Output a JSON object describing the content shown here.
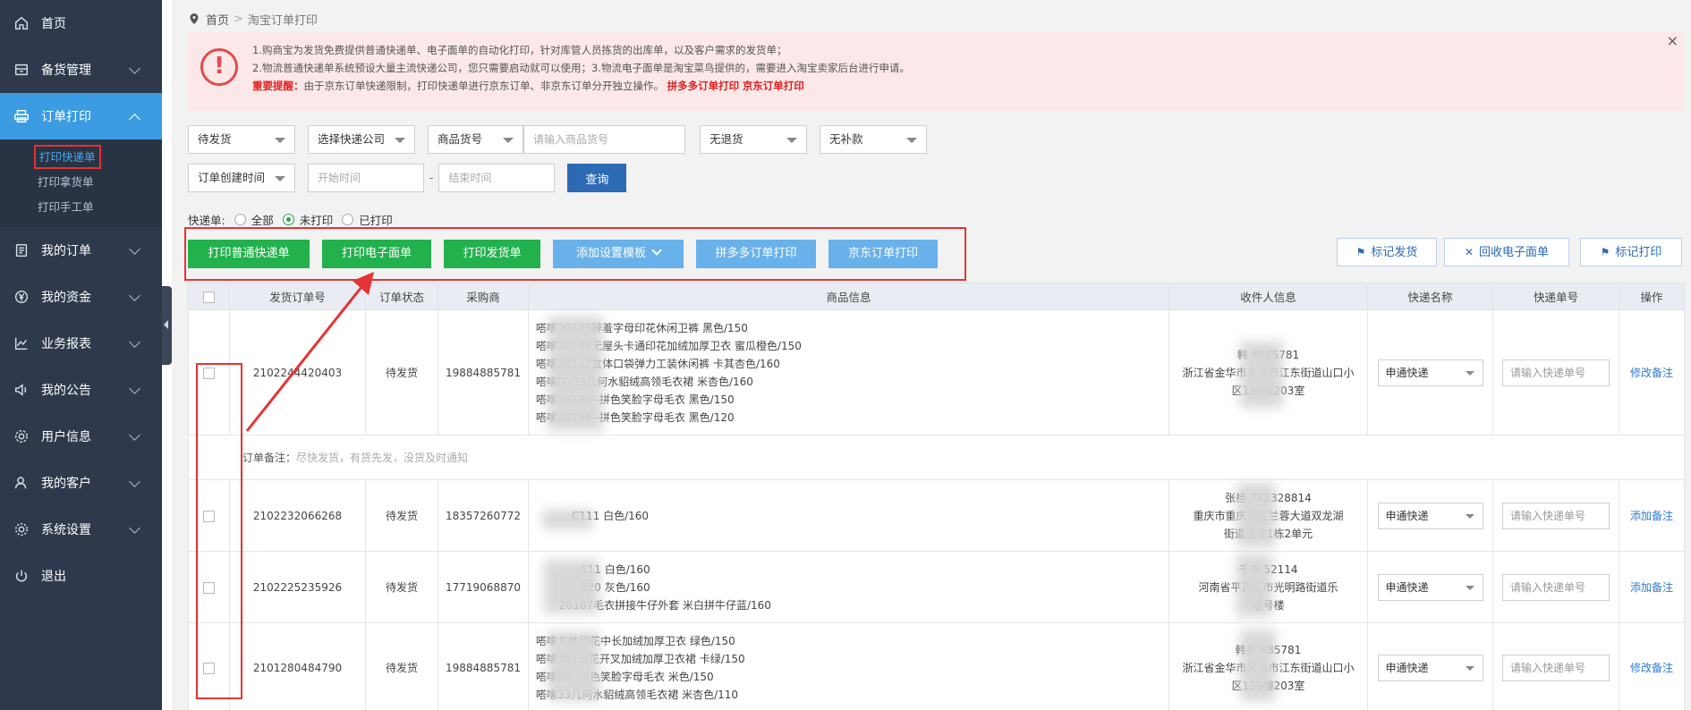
{
  "sidebar": {
    "items": [
      {
        "label": "首页",
        "icon": "home-icon"
      },
      {
        "label": "备货管理",
        "icon": "inventory-icon"
      },
      {
        "label": "订单打印",
        "icon": "printer-icon"
      },
      {
        "label": "我的订单",
        "icon": "order-icon"
      },
      {
        "label": "我的资金",
        "icon": "yen-icon"
      },
      {
        "label": "业务报表",
        "icon": "chart-icon"
      },
      {
        "label": "我的公告",
        "icon": "speaker-icon"
      },
      {
        "label": "用户信息",
        "icon": "user-gear-icon"
      },
      {
        "label": "我的客户",
        "icon": "customer-icon"
      },
      {
        "label": "系统设置",
        "icon": "settings-icon"
      },
      {
        "label": "退出",
        "icon": "power-icon"
      }
    ],
    "sub_items": [
      "打印快递单",
      "打印拿货单",
      "打印手工单"
    ]
  },
  "breadcrumb": {
    "home": "首页",
    "current": "淘宝订单打印"
  },
  "notice": {
    "line1": "1.购商宝为发货免费提供普通快递单、电子面单的自动化打印，针对库管人员拣货的出库单，以及客户需求的发货单；",
    "line2": "2.物流普通快递单系统预设大量主流快递公司，您只需要启动就可以使用；3.物流电子面单是淘宝菜鸟提供的，需要进入淘宝卖家后台进行申请。",
    "warn_label": "重要提醒：",
    "warn_text": "由于京东订单快递限制，打印快递单进行京东订单、非京东订单分开独立操作。",
    "link1": "拼多多订单打印",
    "link2": "京东订单打印",
    "close": "×"
  },
  "filters": {
    "status": "待发货",
    "express_company": "选择快递公司",
    "goods_field": "商品货号",
    "goods_placeholder": "请输入商品货号",
    "return": "无退货",
    "supplement": "无补款",
    "time_type": "订单创建时间",
    "start_placeholder": "开始时间",
    "end_placeholder": "结束时间",
    "dash": "-",
    "query": "查询"
  },
  "express_filter": {
    "label": "快递单:",
    "options": [
      "全部",
      "未打印",
      "已打印"
    ],
    "selected": "未打印"
  },
  "actions": {
    "print_normal": "打印普通快递单",
    "print_electronic": "打印电子面单",
    "print_delivery": "打印发货单",
    "add_template": "添加设置模板",
    "pdd_print": "拼多多订单打印",
    "jd_print": "京东订单打印",
    "mark_ship": "标记发货",
    "recycle": "回收电子面单",
    "mark_print": "标记打印"
  },
  "table": {
    "headers": [
      "发货订单号",
      "订单状态",
      "采购商",
      "商品信息",
      "收件人信息",
      "快递名称",
      "快递单号",
      "操作"
    ],
    "express_default": "申通快递",
    "tracking_placeholder": "请输入快递单号",
    "remark_label": "订单备注：",
    "remark_text": "尽快发货，有货先发，没货及时通知",
    "rows": [
      {
        "order_no": "2102244420403",
        "status": "待发货",
        "buyer": "19884885781",
        "goods": [
          "嗒嗦20123醉羞字母印花休闲卫裤  黑色/150",
          "嗒嗦20248无屋头卡通印花加绒加厚卫衣  蜜瓜橙色/150",
          "嗒嗦20122立体口袋弹力工装休闲裤  卡其杏色/160",
          "嗒嗦D733几何水貂绒高领毛衣裙  米杏色/160",
          "嗒嗦20199--拼色笑脸字母毛衣  黑色/150",
          "嗒嗦20199--拼色笑脸字母毛衣  黑色/120"
        ],
        "receiver": [
          "韩",
          "4885781",
          "浙江省金华市义乌市江东街道山口小",
          "区139幢203室"
        ],
        "op": "修改备注"
      },
      {
        "order_no": "2102232066268",
        "status": "待发货",
        "buyer": "18357260772",
        "goods": [
          "C111  白色/160"
        ],
        "receiver": [
          "张桂",
          "782328814",
          "重庆市重庆市区兰蓉大道双龙湖",
          "街道盛景1栋2单元"
        ],
        "op": "添加备注"
      },
      {
        "order_no": "2102225235926",
        "status": "待发货",
        "buyer": "17719068870",
        "goods": [
          "111  白色/160",
          "120  灰色/160",
          "20167毛衣拼接牛仔外套  米白拼牛仔蓝/160"
        ],
        "receiver": [
          "千千",
          "52114",
          "河南省平顶山市光明路街道乐",
          "福号楼"
        ],
        "op": "添加备注"
      },
      {
        "order_no": "2101280484790",
        "status": "待发货",
        "buyer": "19884885781",
        "goods": [
          "嗒嗦立体印花中长加绒加厚卫衣  绿色/150",
          "嗒嗦301印花开叉加绒加厚卫衣裙  卡绿/150",
          "嗒嗦99--拼色笑脸字母毛衣  米色/150",
          "嗒嗦33几何水貂绒高领毛衣裙  米杏色/110"
        ],
        "receiver": [
          "韩星",
          "885781",
          "浙江省金华市义乌市江东街道山口小",
          "区139幢203室"
        ],
        "op": "修改备注"
      }
    ]
  },
  "colors": {
    "sidebar": "#2e3a4c",
    "active": "#3c9ce2",
    "green": "#23b14d",
    "light_blue": "#69b1ea",
    "query": "#2d6ab4",
    "highlight": "#e53333"
  }
}
